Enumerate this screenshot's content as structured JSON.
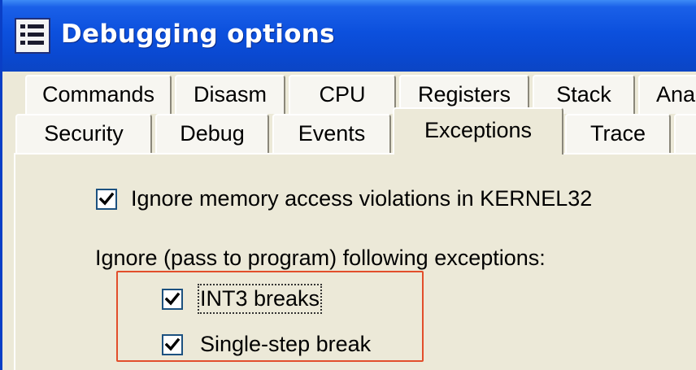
{
  "window": {
    "title": "Debugging options",
    "title_icon": "list-icon"
  },
  "tabs": {
    "row1": [
      {
        "label": "Commands"
      },
      {
        "label": "Disasm"
      },
      {
        "label": "CPU"
      },
      {
        "label": "Registers"
      },
      {
        "label": "Stack"
      },
      {
        "label": "Ana"
      }
    ],
    "row2": [
      {
        "label": "Security"
      },
      {
        "label": "Debug"
      },
      {
        "label": "Events"
      },
      {
        "label": "Exceptions",
        "selected": true
      },
      {
        "label": "Trace"
      }
    ]
  },
  "exceptions": {
    "ignore_kernel32": {
      "label": "Ignore memory access violations in KERNEL32",
      "checked": true
    },
    "section_label": "Ignore (pass to program) following exceptions:",
    "int3_breaks": {
      "label": "INT3 breaks",
      "checked": true
    },
    "single_step": {
      "label": "Single-step break",
      "checked": true
    }
  },
  "colors": {
    "titlebar": "#0c50dd",
    "dialog_bg": "#ece9d8",
    "highlight": "#e24e2b",
    "checkbox_border": "#1c5180",
    "check_mark": "#21a121"
  }
}
